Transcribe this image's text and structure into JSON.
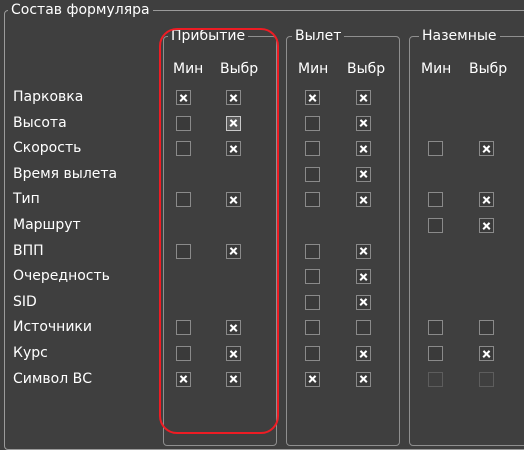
{
  "form_title": "Состав формуляра",
  "groups": [
    {
      "id": "arrival",
      "title": "Прибытие",
      "col_min": "Мин",
      "col_sel": "Выбр"
    },
    {
      "id": "departure",
      "title": "Вылет",
      "col_min": "Мин",
      "col_sel": "Выбр"
    },
    {
      "id": "ground",
      "title": "Наземные",
      "col_min": "Мин",
      "col_sel": "Выбр"
    }
  ],
  "rows": [
    {
      "label": "Парковка",
      "arrival": [
        "on",
        "on"
      ],
      "departure": [
        "on",
        "on"
      ],
      "ground": [
        null,
        null
      ]
    },
    {
      "label": "Высота",
      "arrival": [
        "off",
        "mixed"
      ],
      "departure": [
        "off",
        "on"
      ],
      "ground": [
        null,
        null
      ]
    },
    {
      "label": "Скорость",
      "arrival": [
        "off",
        "on"
      ],
      "departure": [
        "off",
        "on"
      ],
      "ground": [
        "off",
        "on"
      ]
    },
    {
      "label": "Время вылета",
      "arrival": [
        null,
        null
      ],
      "departure": [
        "off",
        "on"
      ],
      "ground": [
        null,
        null
      ]
    },
    {
      "label": "Тип",
      "arrival": [
        "off",
        "on"
      ],
      "departure": [
        "off",
        "on"
      ],
      "ground": [
        "off",
        "on"
      ]
    },
    {
      "label": "Маршрут",
      "arrival": [
        null,
        null
      ],
      "departure": [
        null,
        null
      ],
      "ground": [
        "off",
        "on"
      ]
    },
    {
      "label": "ВПП",
      "arrival": [
        "off",
        "on"
      ],
      "departure": [
        "off",
        "on"
      ],
      "ground": [
        null,
        null
      ]
    },
    {
      "label": "Очередность",
      "arrival": [
        null,
        null
      ],
      "departure": [
        "off",
        "on"
      ],
      "ground": [
        null,
        null
      ]
    },
    {
      "label": "SID",
      "arrival": [
        null,
        null
      ],
      "departure": [
        "off",
        "on"
      ],
      "ground": [
        null,
        null
      ]
    },
    {
      "label": "Источники",
      "arrival": [
        "off",
        "on"
      ],
      "departure": [
        "off",
        "off"
      ],
      "ground": [
        "off",
        "off"
      ]
    },
    {
      "label": "Курс",
      "arrival": [
        "off",
        "on"
      ],
      "departure": [
        "off",
        "on"
      ],
      "ground": [
        "off",
        "on"
      ]
    },
    {
      "label": "Символ ВС",
      "arrival": [
        "on",
        "on"
      ],
      "departure": [
        "on",
        "on"
      ],
      "ground": [
        "disabled",
        "disabled"
      ]
    }
  ],
  "annotation": {
    "color": "#ee1c24",
    "shape": "rounded-rectangle",
    "target": "arrival"
  }
}
